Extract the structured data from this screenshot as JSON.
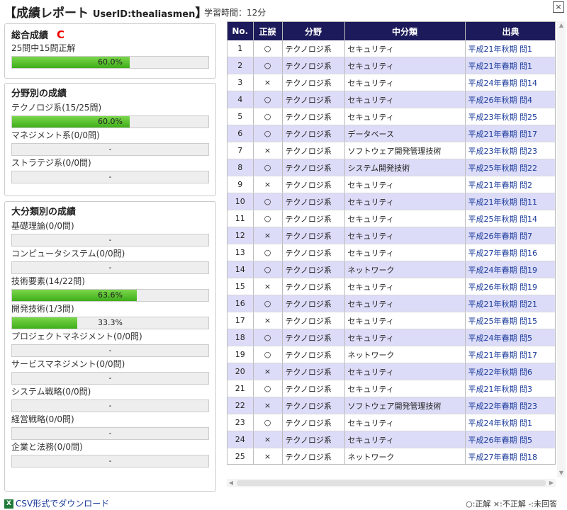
{
  "header": {
    "title": "【成績レポート",
    "user_id": "UserID:thealiasmen",
    "title_close": "】",
    "study_time": "学習時間：12分",
    "close_label": "×"
  },
  "overall": {
    "title": "総合成績",
    "grade": "C",
    "summary": "25問中15問正解",
    "percent_text": "60.0%",
    "percent": 60.0
  },
  "field": {
    "title": "分野別の成績",
    "items": [
      {
        "label": "テクノロジ系(15/25問)",
        "percent_text": "60.0%",
        "percent": 60.0
      },
      {
        "label": "マネジメント系(0/0問)",
        "percent_text": "-",
        "percent": 0
      },
      {
        "label": "ストラテジ系(0/0問)",
        "percent_text": "-",
        "percent": 0
      }
    ]
  },
  "major": {
    "title": "大分類別の成績",
    "items": [
      {
        "label": "基礎理論(0/0問)",
        "percent_text": "-",
        "percent": 0
      },
      {
        "label": "コンピュータシステム(0/0問)",
        "percent_text": "-",
        "percent": 0
      },
      {
        "label": "技術要素(14/22問)",
        "percent_text": "63.6%",
        "percent": 63.6
      },
      {
        "label": "開発技術(1/3問)",
        "percent_text": "33.3%",
        "percent": 33.3
      },
      {
        "label": "プロジェクトマネジメント(0/0問)",
        "percent_text": "-",
        "percent": 0
      },
      {
        "label": "サービスマネジメント(0/0問)",
        "percent_text": "-",
        "percent": 0
      },
      {
        "label": "システム戦略(0/0問)",
        "percent_text": "-",
        "percent": 0
      },
      {
        "label": "経営戦略(0/0問)",
        "percent_text": "-",
        "percent": 0
      },
      {
        "label": "企業と法務(0/0問)",
        "percent_text": "-",
        "percent": 0
      }
    ]
  },
  "table": {
    "headers": [
      "No.",
      "正誤",
      "分野",
      "中分類",
      "出典"
    ],
    "rows": [
      [
        "1",
        "○",
        "テクノロジ系",
        "セキュリティ",
        "平成21年秋期 問1"
      ],
      [
        "2",
        "○",
        "テクノロジ系",
        "セキュリティ",
        "平成21年春期 問1"
      ],
      [
        "3",
        "×",
        "テクノロジ系",
        "セキュリティ",
        "平成24年春期 問14"
      ],
      [
        "4",
        "○",
        "テクノロジ系",
        "セキュリティ",
        "平成26年秋期 問4"
      ],
      [
        "5",
        "○",
        "テクノロジ系",
        "セキュリティ",
        "平成23年秋期 問25"
      ],
      [
        "6",
        "○",
        "テクノロジ系",
        "データベース",
        "平成21年春期 問17"
      ],
      [
        "7",
        "×",
        "テクノロジ系",
        "ソフトウェア開発管理技術",
        "平成23年秋期 問23"
      ],
      [
        "8",
        "○",
        "テクノロジ系",
        "システム開発技術",
        "平成25年秋期 問22"
      ],
      [
        "9",
        "×",
        "テクノロジ系",
        "セキュリティ",
        "平成21年春期 問2"
      ],
      [
        "10",
        "○",
        "テクノロジ系",
        "セキュリティ",
        "平成21年秋期 問11"
      ],
      [
        "11",
        "○",
        "テクノロジ系",
        "セキュリティ",
        "平成25年秋期 問14"
      ],
      [
        "12",
        "×",
        "テクノロジ系",
        "セキュリティ",
        "平成26年春期 問7"
      ],
      [
        "13",
        "○",
        "テクノロジ系",
        "セキュリティ",
        "平成27年春期 問16"
      ],
      [
        "14",
        "○",
        "テクノロジ系",
        "ネットワーク",
        "平成24年春期 問19"
      ],
      [
        "15",
        "×",
        "テクノロジ系",
        "セキュリティ",
        "平成26年秋期 問19"
      ],
      [
        "16",
        "○",
        "テクノロジ系",
        "セキュリティ",
        "平成21年秋期 問21"
      ],
      [
        "17",
        "×",
        "テクノロジ系",
        "セキュリティ",
        "平成25年春期 問15"
      ],
      [
        "18",
        "○",
        "テクノロジ系",
        "セキュリティ",
        "平成24年春期 問5"
      ],
      [
        "19",
        "○",
        "テクノロジ系",
        "ネットワーク",
        "平成21年春期 問17"
      ],
      [
        "20",
        "×",
        "テクノロジ系",
        "セキュリティ",
        "平成22年秋期 問6"
      ],
      [
        "21",
        "○",
        "テクノロジ系",
        "セキュリティ",
        "平成21年秋期 問3"
      ],
      [
        "22",
        "×",
        "テクノロジ系",
        "ソフトウェア開発管理技術",
        "平成22年春期 問23"
      ],
      [
        "23",
        "○",
        "テクノロジ系",
        "セキュリティ",
        "平成24年秋期 問1"
      ],
      [
        "24",
        "×",
        "テクノロジ系",
        "セキュリティ",
        "平成26年春期 問5"
      ],
      [
        "25",
        "×",
        "テクノロジ系",
        "ネットワーク",
        "平成27年春期 問18"
      ]
    ]
  },
  "footer": {
    "csv_icon": "X",
    "csv_label": "CSV形式でダウンロード",
    "legend": "○:正解 ×:不正解 -:未回答"
  }
}
